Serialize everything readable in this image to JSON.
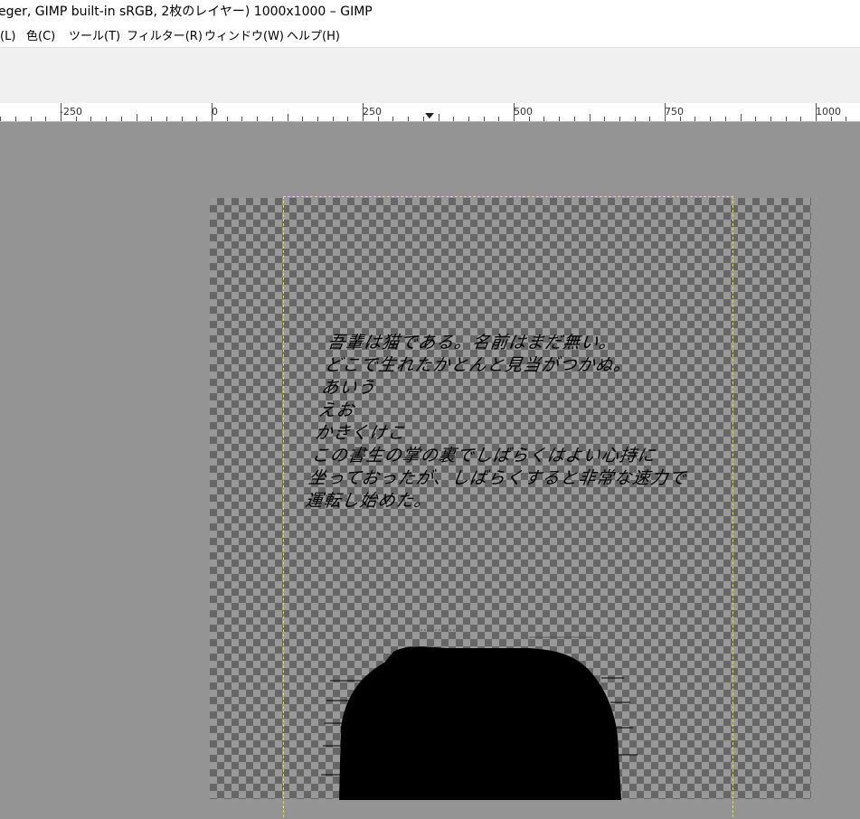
{
  "window": {
    "title": "eger, GIMP built-in sRGB, 2枚のレイヤー) 1000x1000 – GIMP"
  },
  "menubar": {
    "items": [
      {
        "label": "(L)"
      },
      {
        "label": "色(C)"
      },
      {
        "label": "ツール(T)"
      },
      {
        "label": "フィルター(R)"
      },
      {
        "label": "ウィンドウ(W)"
      },
      {
        "label": "ヘルプ(H)"
      }
    ]
  },
  "ruler": {
    "labels": [
      "-250",
      "0",
      "250",
      "500",
      "750",
      "1000"
    ]
  },
  "canvas": {
    "text_lines": [
      "吾輩は猫である。名前はまだ無い。",
      "どこで生れたかとんと見当がつかぬ。",
      "あいう",
      "えお",
      "かきくけこ",
      "この書生の掌の裏でしばらくはよい心持に",
      "坐っておったが、しばらくすると非常な速力で",
      "運転し始めた。"
    ]
  },
  "colors": {
    "canvas_bg": "#949494",
    "checker_light": "#999999",
    "checker_dark": "#666666",
    "layer_boundary": "#e6e600",
    "toolbar_bg": "#f0f0f0"
  }
}
